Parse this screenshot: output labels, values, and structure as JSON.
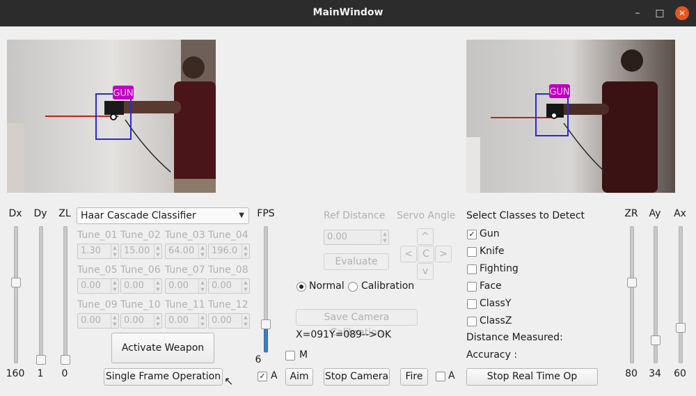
{
  "window": {
    "title": "MainWindow"
  },
  "titlebar": {
    "minimize_icon": "minimize-icon",
    "maximize_icon": "maximize-icon",
    "close_icon": "close-icon"
  },
  "cameras": {
    "left": {
      "label": "GUN"
    },
    "right": {
      "label": "GUN"
    }
  },
  "left_sliders": [
    {
      "label": "Dx",
      "value": "160",
      "level": 0.6
    },
    {
      "label": "Dy",
      "value": "1",
      "level": 0.0
    },
    {
      "label": "ZL",
      "value": "0",
      "level": 0.0
    }
  ],
  "fps": {
    "label": "FPS",
    "value": "6",
    "level": 0.3
  },
  "right_sliders": [
    {
      "label": "ZR",
      "value": "80",
      "level": 0.6
    },
    {
      "label": "Ay",
      "value": "34",
      "level": 0.15
    },
    {
      "label": "Ax",
      "value": "60",
      "level": 0.25
    }
  ],
  "classifier": {
    "selected": "Haar Cascade Classifier"
  },
  "tunes": [
    {
      "label": "Tune_01",
      "value": "1.30"
    },
    {
      "label": "Tune_02",
      "value": "15.00"
    },
    {
      "label": "Tune_03",
      "value": "64.00"
    },
    {
      "label": "Tune_04",
      "value": "196.0"
    },
    {
      "label": "Tune_05",
      "value": "0.00"
    },
    {
      "label": "Tune_06",
      "value": "0.00"
    },
    {
      "label": "Tune_07",
      "value": "0.00"
    },
    {
      "label": "Tune_08",
      "value": "0.00"
    },
    {
      "label": "Tune_09",
      "value": "0.00"
    },
    {
      "label": "Tune_10",
      "value": "0.00"
    },
    {
      "label": "Tune_11",
      "value": "0.00"
    },
    {
      "label": "Tune_12",
      "value": "0.00"
    }
  ],
  "buttons": {
    "activate_weapon": "Activate Weapon",
    "single_frame": "Single Frame Operation",
    "aim": "Aim",
    "stop_camera": "Stop Camera",
    "fire": "Fire",
    "stop_realtime": "Stop Real Time Op",
    "evaluate": "Evaluate",
    "save_calibration": "Save Camera Calibration"
  },
  "checks": {
    "m": "M",
    "a_left": "A",
    "a_right": "A"
  },
  "ref_distance": {
    "label": "Ref Distance",
    "value": "0.00"
  },
  "servo": {
    "label": "Servo Angle",
    "up": "^",
    "left": "<",
    "center": "C",
    "right": ">",
    "down": "v"
  },
  "mode": {
    "normal": "Normal",
    "calibration": "Calibration",
    "selected": "normal"
  },
  "status_text": "X=091Y=089-->OK",
  "classes": {
    "title": "Select Classes to Detect",
    "items": [
      {
        "label": "Gun",
        "checked": true
      },
      {
        "label": "Knife",
        "checked": false
      },
      {
        "label": "Fighting",
        "checked": false
      },
      {
        "label": "Face",
        "checked": false
      },
      {
        "label": "ClassY",
        "checked": false
      },
      {
        "label": "ClassZ",
        "checked": false
      }
    ]
  },
  "distance_label": "Distance Measured:",
  "accuracy_label": "Accuracy :",
  "colors": {
    "titlebar": "#2c2c2c",
    "close": "#e9541f",
    "detection_box": "#2a2ad0",
    "detection_label": "#c000c0",
    "fps_fill": "#3b7fc4"
  }
}
